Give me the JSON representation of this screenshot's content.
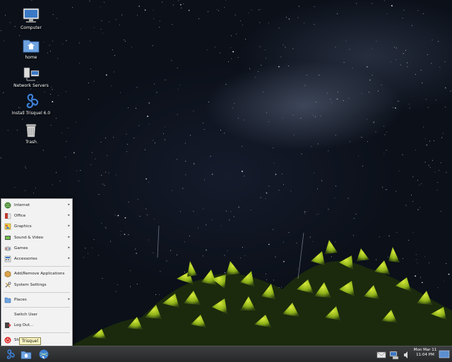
{
  "desktop": {
    "icons": [
      {
        "label": "Computer",
        "icon": "computer-icon"
      },
      {
        "label": "home",
        "icon": "home-folder-icon"
      },
      {
        "label": "Network Servers",
        "icon": "network-servers-icon"
      },
      {
        "label": "Install Trisquel 6.0",
        "icon": "trisquel-installer-icon"
      },
      {
        "label": "Trash",
        "icon": "trash-icon"
      }
    ]
  },
  "menu": {
    "items": [
      {
        "label": "Internet",
        "icon": "globe-icon",
        "submenu": true
      },
      {
        "label": "Office",
        "icon": "office-icon",
        "submenu": true
      },
      {
        "label": "Graphics",
        "icon": "graphics-icon",
        "submenu": true
      },
      {
        "label": "Sound & Video",
        "icon": "sound-video-icon",
        "submenu": true
      },
      {
        "label": "Games",
        "icon": "games-icon",
        "submenu": true
      },
      {
        "label": "Accessories",
        "icon": "accessories-icon",
        "submenu": true
      },
      {
        "label": "Add/Remove Applications",
        "icon": "package-icon",
        "submenu": false
      },
      {
        "label": "System Settings",
        "icon": "settings-icon",
        "submenu": false
      },
      {
        "label": "Places",
        "icon": "folder-icon",
        "submenu": true
      },
      {
        "label": "Switch User",
        "icon": "",
        "submenu": false
      },
      {
        "label": "Log Out...",
        "icon": "logout-icon",
        "submenu": false
      },
      {
        "label": "Shu",
        "icon": "shutdown-icon",
        "submenu": false
      }
    ],
    "submenu_arrow": "▸"
  },
  "tooltip": {
    "text": "Trisquel"
  },
  "panel": {
    "clock_line1": "Mon Mar 11",
    "clock_line2": "11:04 PM"
  }
}
